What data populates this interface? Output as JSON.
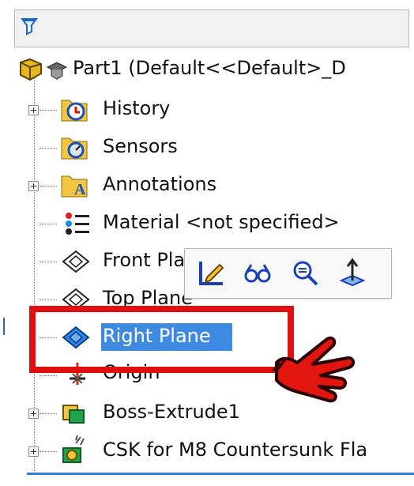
{
  "filter": {
    "icon": "funnel-filter-icon"
  },
  "tree": {
    "root": {
      "label": "Part1  (Default<<Default>_D",
      "icons": [
        "part-icon",
        "tessellation-icon"
      ]
    },
    "items": [
      {
        "label": "History",
        "icon": "history-clock-icon",
        "expandable": true
      },
      {
        "label": "Sensors",
        "icon": "sensors-gauge-icon",
        "expandable": false
      },
      {
        "label": "Annotations",
        "icon": "annotations-a-icon",
        "expandable": true
      },
      {
        "label": "Material <not specified>",
        "icon": "material-icon",
        "expandable": false
      },
      {
        "label": "Front Plane",
        "icon": "plane-icon",
        "expandable": false
      },
      {
        "label": "Top Plane",
        "icon": "plane-icon",
        "expandable": false
      },
      {
        "label": "Right Plane",
        "icon": "plane-selected-icon",
        "expandable": false,
        "selected": true
      },
      {
        "label": "Origin",
        "icon": "origin-icon",
        "expandable": false
      },
      {
        "label": "Boss-Extrude1",
        "icon": "boss-extrude-icon",
        "expandable": true
      },
      {
        "label": "CSK for M8 Countersunk Fla",
        "icon": "hole-wizard-icon",
        "expandable": true
      }
    ]
  },
  "context_toolbar": {
    "tools": [
      "edit-sketch-icon",
      "view-glasses-icon",
      "zoom-to-selection-icon",
      "normal-to-icon"
    ]
  },
  "colors": {
    "selection": "#3e8ae3",
    "highlight": "#e01010",
    "accent": "#2f7de0"
  },
  "overlay": {
    "pointer": "hand-pointer-icon"
  }
}
